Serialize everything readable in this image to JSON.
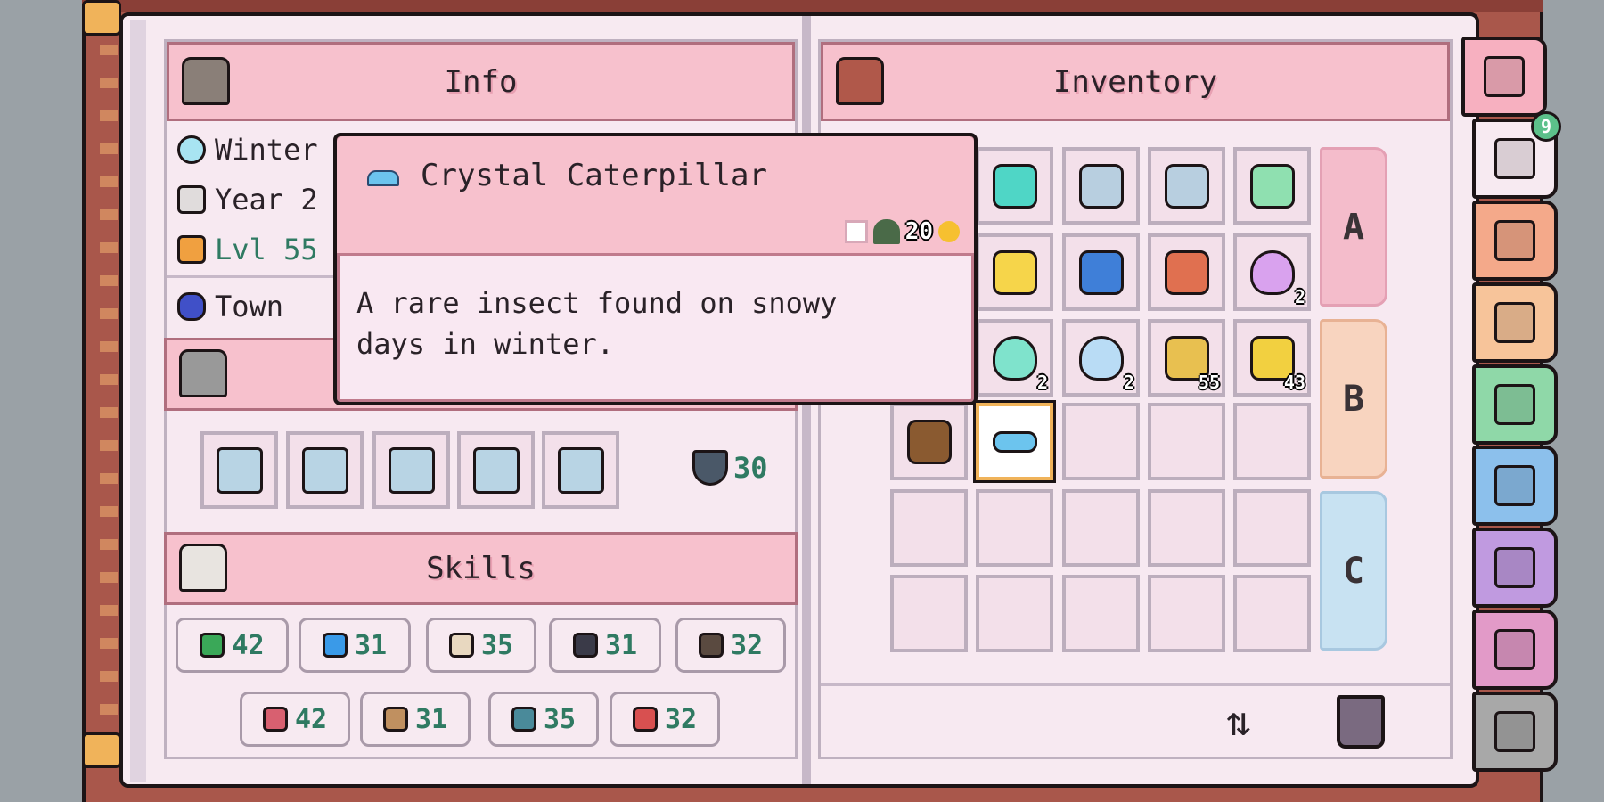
{
  "info": {
    "title": "Info",
    "season": "Winter",
    "year": "Year 2",
    "level": "Lvl 55",
    "location": "Town"
  },
  "equipment": {
    "slots": [
      "helmet",
      "chestplate",
      "leggings",
      "boots",
      "sword"
    ],
    "armor": "30"
  },
  "skills": {
    "title": "Skills",
    "row1": [
      {
        "icon": "farming-icon",
        "value": "42"
      },
      {
        "icon": "fishing-icon",
        "value": "31"
      },
      {
        "icon": "cooking-icon",
        "value": "35"
      },
      {
        "icon": "foraging-icon",
        "value": "31"
      },
      {
        "icon": "mining-icon",
        "value": "32"
      }
    ],
    "row2": [
      {
        "icon": "ranching-icon",
        "value": "42"
      },
      {
        "icon": "bug-catching-icon",
        "value": "31"
      },
      {
        "icon": "crafting-icon",
        "value": "35"
      },
      {
        "icon": "combat-icon",
        "value": "32"
      }
    ]
  },
  "inventory": {
    "title": "Inventory",
    "tabs": [
      "A",
      "B",
      "C"
    ],
    "rows": [
      [
        null,
        {
          "name": "pickaxe",
          "color": "#4fd6c6"
        },
        {
          "name": "axe",
          "color": "#b8cfe0"
        },
        {
          "name": "shovel",
          "color": "#b8cfe0"
        },
        {
          "name": "bug-net",
          "color": "#8fe0b0"
        }
      ],
      [
        null,
        {
          "name": "egg-tart",
          "color": "#f6d54a"
        },
        {
          "name": "blue-vase",
          "color": "#3f7fd8"
        },
        {
          "name": "pizza",
          "color": "#e07050"
        },
        {
          "name": "purple-heart",
          "color": "#d9a2ee",
          "count": "2"
        }
      ],
      [
        null,
        {
          "name": "teal-heart",
          "color": "#7fe3cc",
          "count": "2"
        },
        {
          "name": "blue-heart",
          "color": "#b9dcf5",
          "count": "2"
        },
        {
          "name": "hay",
          "color": "#e8c050",
          "count": "55"
        },
        {
          "name": "yellow-seed",
          "color": "#f2d040",
          "count": "43"
        }
      ],
      [
        {
          "name": "acorn",
          "color": "#8a5a30"
        },
        {
          "name": "crystal-caterpillar",
          "color": "#6cc4ee",
          "selected": true
        },
        null,
        null,
        null
      ],
      [
        null,
        null,
        null,
        null,
        null
      ],
      [
        null,
        null,
        null,
        null,
        null
      ]
    ]
  },
  "tooltip": {
    "name": "Crystal Caterpillar",
    "price": "20",
    "description": "A rare insect found on snowy days in winter."
  },
  "side_tabs": [
    {
      "name": "inventory",
      "color": "#f7b0c0"
    },
    {
      "name": "clothing",
      "color": "#f7eaf1",
      "badge": "9"
    },
    {
      "name": "mail",
      "color": "#f4a98a"
    },
    {
      "name": "relationships",
      "color": "#f7c49a"
    },
    {
      "name": "character",
      "color": "#8fd8a8"
    },
    {
      "name": "magic",
      "color": "#8cc0ec"
    },
    {
      "name": "map",
      "color": "#c09ae0"
    },
    {
      "name": "journal",
      "color": "#e29ac8"
    },
    {
      "name": "settings",
      "color": "#a8a8a8"
    }
  ],
  "colors": {
    "header": "#f7c1cd",
    "page": "#f7eaf1",
    "level": "#2f7a62",
    "selected": "#f0b35a"
  }
}
